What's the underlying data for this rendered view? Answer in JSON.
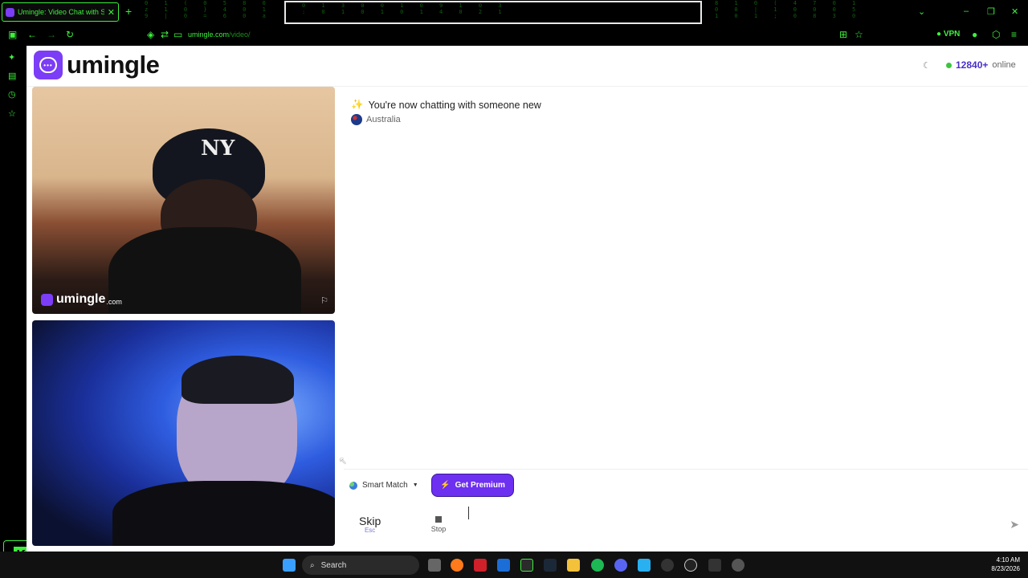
{
  "browser": {
    "tab_title": "Umingle: Video Chat with Stran",
    "url_domain": "umingle.com",
    "url_path": "/video/",
    "vpn_label": "VPN",
    "new_tab": "+"
  },
  "site": {
    "logo_text": "umingle",
    "online_count": "12840+",
    "online_label": "online"
  },
  "video": {
    "watermark_text": "umingle",
    "watermark_suffix": ".com"
  },
  "chat": {
    "status_message": "You're now chatting with someone new",
    "country": "Australia"
  },
  "controls": {
    "match_mode": "Smart Match",
    "premium_label": "Get Premium",
    "skip_label": "Skip",
    "skip_key": "Esc",
    "stop_label": "Stop",
    "message_placeholder": ""
  },
  "taskbar": {
    "search_label": "Search",
    "time": "4:10 AM",
    "date": "8/23/2026"
  },
  "colors": {
    "brand": "#7b3df6",
    "browser_accent": "#3df03d",
    "premium_button": "#6d2ff0",
    "online_dot": "#3ec43e"
  }
}
